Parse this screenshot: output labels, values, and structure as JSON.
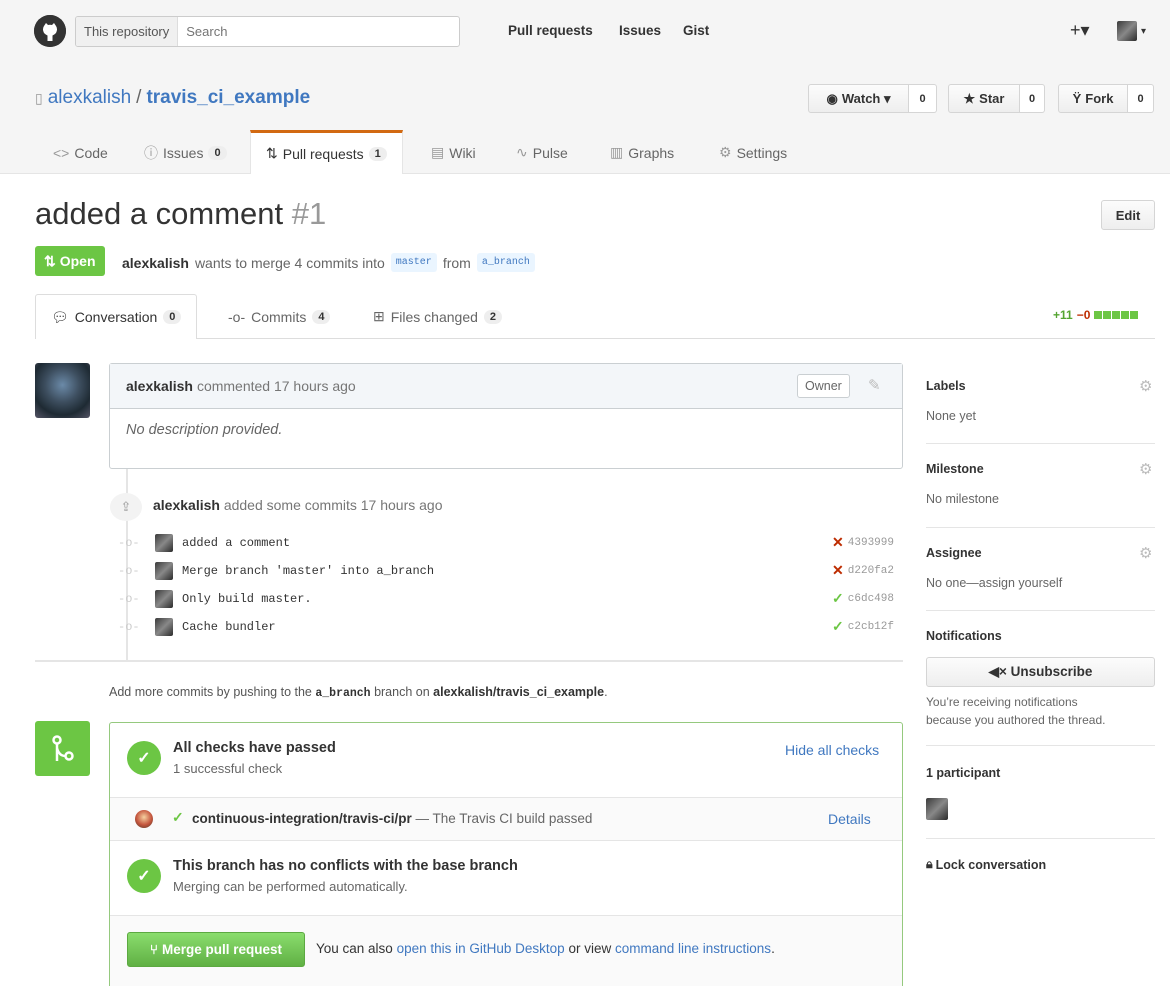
{
  "header": {
    "search_scope": "This repository",
    "search_placeholder": "Search",
    "nav": [
      "Pull requests",
      "Issues",
      "Gist"
    ],
    "plus": "+▾"
  },
  "repo": {
    "owner": "alexkalish",
    "separator": "/",
    "name": "travis_ci_example",
    "watch_label": "Watch ▾",
    "watch_count": "0",
    "star_label": "Star",
    "star_count": "0",
    "fork_label": "Fork",
    "fork_count": "0"
  },
  "reponav": [
    {
      "label": "Code",
      "icon": "<>",
      "count": ""
    },
    {
      "label": "Issues",
      "icon": "ⓘ",
      "count": "0"
    },
    {
      "label": "Pull requests",
      "icon": "⇅",
      "count": "1"
    },
    {
      "label": "Wiki",
      "icon": "▤",
      "count": ""
    },
    {
      "label": "Pulse",
      "icon": "∿",
      "count": ""
    },
    {
      "label": "Graphs",
      "icon": "▥",
      "count": ""
    },
    {
      "label": "Settings",
      "icon": "⚙",
      "count": ""
    }
  ],
  "pr": {
    "title": "added a comment",
    "number": "#1",
    "edit_label": "Edit",
    "state": "Open",
    "author": "alexkalish",
    "merge_text_1": "wants to merge 4 commits into",
    "base": "master",
    "from_word": "from",
    "head": "a_branch"
  },
  "tabs": [
    {
      "label": "Conversation",
      "count": "0"
    },
    {
      "label": "Commits",
      "count": "4"
    },
    {
      "label": "Files changed",
      "count": "2"
    }
  ],
  "diffstat": {
    "added": "+11",
    "removed": "−0"
  },
  "comment": {
    "author": "alexkalish",
    "meta": "commented 17 hours ago",
    "owner_label": "Owner",
    "body": "No description provided."
  },
  "commits_event": {
    "author": "alexkalish",
    "meta": "added some commits 17 hours ago",
    "commits": [
      {
        "message": "added a comment",
        "sha": "4393999",
        "status": "fail"
      },
      {
        "message": "Merge branch 'master' into a_branch",
        "sha": "d220fa2",
        "status": "fail"
      },
      {
        "message": "Only build master.",
        "sha": "c6dc498",
        "status": "pass"
      },
      {
        "message": "Cache bundler",
        "sha": "c2cb12f",
        "status": "pass"
      }
    ]
  },
  "push_hint": {
    "pre": "Add more commits by pushing to the",
    "branch": "a_branch",
    "mid": "branch on",
    "repo": "alexkalish/travis_ci_example",
    "post": "."
  },
  "merge_box": {
    "checks_title": "All checks have passed",
    "checks_sub": "1 successful check",
    "hide_checks": "Hide all checks",
    "check_name": "continuous-integration/travis-ci/pr",
    "check_desc": "— The Travis CI build passed",
    "details": "Details",
    "conflict_title": "This branch has no conflicts with the base branch",
    "conflict_sub": "Merging can be performed automatically.",
    "merge_button": "Merge pull request",
    "alt_pre": "You can also",
    "alt_link1": "open this in GitHub Desktop",
    "alt_mid": "or view",
    "alt_link2": "command line instructions",
    "alt_post": "."
  },
  "sidebar": {
    "labels_h": "Labels",
    "labels_v": "None yet",
    "milestone_h": "Milestone",
    "milestone_v": "No milestone",
    "assignee_h": "Assignee",
    "assignee_v": "No one—assign yourself",
    "notifications_h": "Notifications",
    "unsubscribe": "◀× Unsubscribe",
    "notif_reason_1": "You’re receiving notifications",
    "notif_reason_2": "because you authored the thread.",
    "participants": "1 participant",
    "lock": "Lock conversation"
  },
  "colors": {
    "accent": "#4078c0",
    "success": "#6cc644",
    "fail": "#bd2c00",
    "tab_active": "#d26911"
  }
}
